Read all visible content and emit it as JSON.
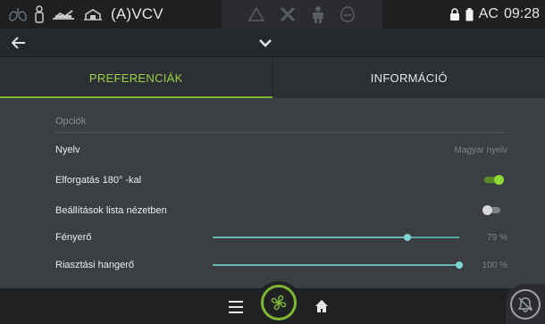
{
  "status": {
    "mode": "(A)VCV",
    "battery_label": "AC",
    "time": "09:28"
  },
  "tabs": [
    {
      "label": "PREFERENCIÁK",
      "active": true
    },
    {
      "label": "INFORMÁCIÓ",
      "active": false
    }
  ],
  "section": {
    "title": "Opciók"
  },
  "settings": {
    "language": {
      "label": "Nyelv",
      "value": "Magyar nyelv"
    },
    "rotate": {
      "label": "Elforgatás 180° -kal",
      "on": true
    },
    "list_view": {
      "label": "Beállítások lista nézetben",
      "on": false
    },
    "brightness": {
      "label": "Fényerő",
      "value_text": "79 %",
      "value": 79
    },
    "alarm_volume": {
      "label": "Riasztási hangerő",
      "value_text": "100 %",
      "value": 100
    }
  },
  "colors": {
    "accent": "#7fb634",
    "slider": "#6cb7b3",
    "background": "#3b3f43"
  },
  "icons": {
    "status_left": [
      "lungs-icon",
      "patient-icon",
      "adult-patient-icon",
      "pediatric-patient-icon"
    ],
    "status_center": [
      "warning-triangle-icon",
      "tools-icon",
      "person-icon",
      "mask-icon"
    ],
    "status_right": [
      "lock-icon",
      "battery-icon"
    ],
    "nav": [
      "back-arrow-icon",
      "chevron-down-icon"
    ],
    "bottom": [
      "menu-icon",
      "fan-icon",
      "home-icon",
      "alarm-silence-icon"
    ]
  }
}
